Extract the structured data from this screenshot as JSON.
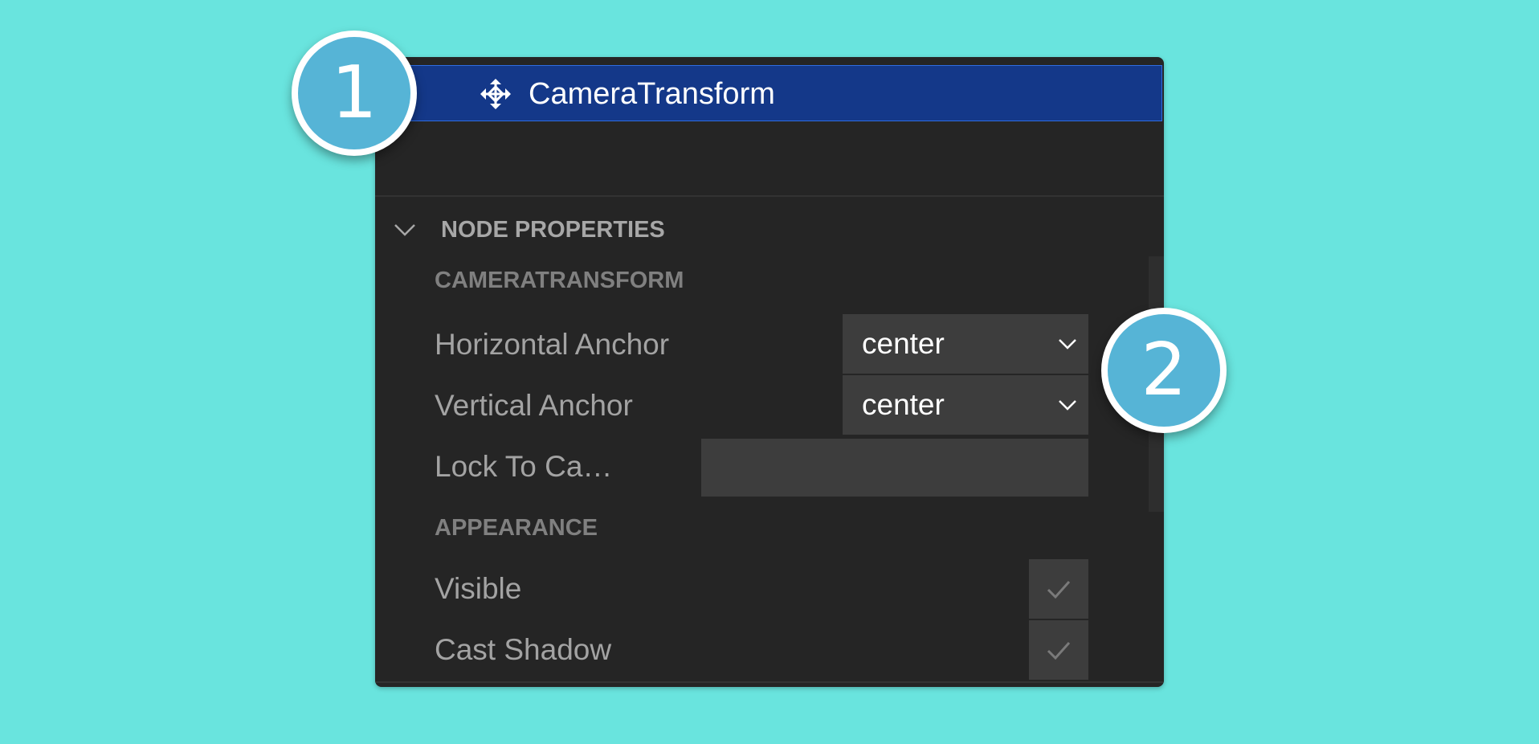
{
  "selected_node": {
    "label": "CameraTransform",
    "icon": "move-arrows-icon",
    "highlight_color": "#143889"
  },
  "section": {
    "title": "NODE PROPERTIES",
    "icon": "chevron-down-icon"
  },
  "groups": {
    "camera_transform": {
      "title": "CAMERATRANSFORM",
      "horizontal_anchor": {
        "label": "Horizontal Anchor",
        "value": "center"
      },
      "vertical_anchor": {
        "label": "Vertical Anchor",
        "value": "center"
      },
      "lock_to_camera": {
        "label": "Lock To Ca…",
        "value": ""
      }
    },
    "appearance": {
      "title": "APPEARANCE",
      "visible": {
        "label": "Visible",
        "checked": true
      },
      "cast_shadow": {
        "label": "Cast Shadow",
        "checked": true
      }
    }
  },
  "callouts": [
    {
      "number": "1"
    },
    {
      "number": "2"
    }
  ],
  "colors": {
    "background": "#69e4de",
    "panel": "#252525",
    "callout": "#56b4d6"
  }
}
